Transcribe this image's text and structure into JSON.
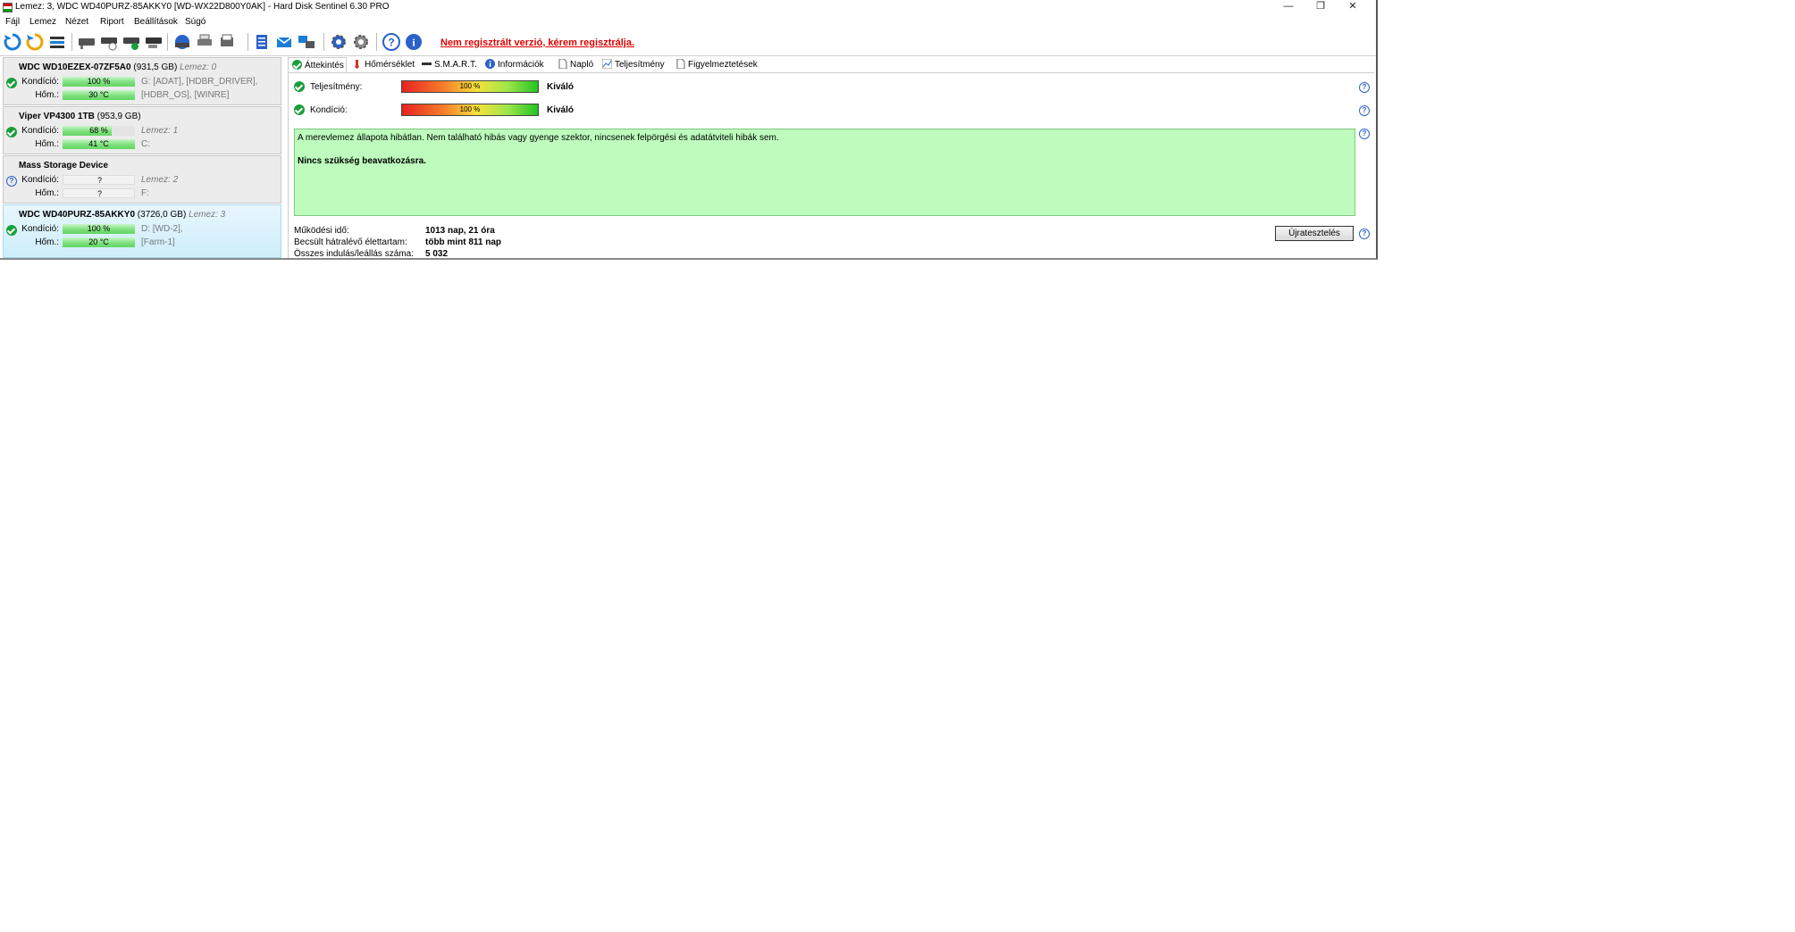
{
  "window": {
    "title": "Lemez: 3, WDC WD40PURZ-85AKKY0 [WD-WX22D800Y0AK]  -  Hard Disk Sentinel 6.30 PRO",
    "minimize": "—",
    "restore": "❐",
    "close": "✕"
  },
  "menu": [
    "Fájl",
    "Lemez",
    "Nézet",
    "Riport",
    "Beállítások",
    "Súgó"
  ],
  "register_warning": "Nem regisztrált verzió, kérem regisztrálja.",
  "disks": [
    {
      "name": "WDC WD10EZEX-07ZF5A0",
      "size": "(931,5 GB)",
      "disk_no": "Lemez: 0",
      "cond_label": "Kondíció:",
      "cond": "100 %",
      "cond_pct": 100,
      "vol1": "G: [ADAT],  [HDBR_DRIVER],",
      "temp_label": "Hőm.:",
      "temp": "30 °C",
      "temp_pct": 100,
      "vol2": "[HDBR_OS],  [WINRE]",
      "status": "ok"
    },
    {
      "name": "Viper VP4300 1TB",
      "size": "(953,9 GB)",
      "disk_no": "",
      "cond_label": "Kondíció:",
      "cond": "68 %",
      "cond_pct": 68,
      "vol1": "Lemez: 1",
      "temp_label": "Hőm.:",
      "temp": "41 °C",
      "temp_pct": 100,
      "vol2": "C:",
      "status": "ok"
    },
    {
      "name": "Mass   Storage Device",
      "size": "",
      "disk_no": "",
      "cond_label": "Kondíció:",
      "cond": "?",
      "cond_pct": 0,
      "vol1": "Lemez: 2",
      "temp_label": "Hőm.:",
      "temp": "?",
      "temp_pct": 0,
      "vol2": "F:",
      "status": "unknown"
    },
    {
      "name": "WDC WD40PURZ-85AKKY0",
      "size": "(3726,0 GB)",
      "disk_no": "Lemez: 3",
      "cond_label": "Kondíció:",
      "cond": "100 %",
      "cond_pct": 100,
      "vol1": "D: [WD-2],",
      "temp_label": "Hőm.:",
      "temp": "20 °C",
      "temp_pct": 100,
      "vol2": "[Farm-1]",
      "status": "ok"
    }
  ],
  "tabs": [
    "Áttekintés",
    "Hőmérséklet",
    "S.M.A.R.T.",
    "Információk",
    "Napló",
    "Teljesítmény",
    "Figyelmeztetések"
  ],
  "overview": {
    "perf_label": "Teljesítmény:",
    "perf_value": "100 %",
    "perf_pct": 100,
    "perf_rating": "Kiváló",
    "cond_label": "Kondíció:",
    "cond_value": "100 %",
    "cond_pct": 100,
    "cond_rating": "Kiváló",
    "message": "A merevlemez állapota hibátlan. Nem található hibás vagy gyenge szektor, nincsenek felpörgési és adatátviteli hibák sem.",
    "recommendation": "Nincs szükség beavatkozásra.",
    "uptime_label": "Működési idő:",
    "uptime_value": "1013 nap, 21 óra",
    "lifetime_label": "Becsült hátralévő élettartam:",
    "lifetime_value": "több mint 811 nap",
    "starts_label": "Összes indulás/leállás száma:",
    "starts_value": "5 032",
    "retest_button": "Újratesztelés",
    "help_glyph": "?"
  },
  "colors": {
    "accent_ok": "#1a9e3a",
    "warning_red": "#e00000",
    "status_box": "#bdfcbd",
    "selected_disk": "#cdeefb"
  }
}
